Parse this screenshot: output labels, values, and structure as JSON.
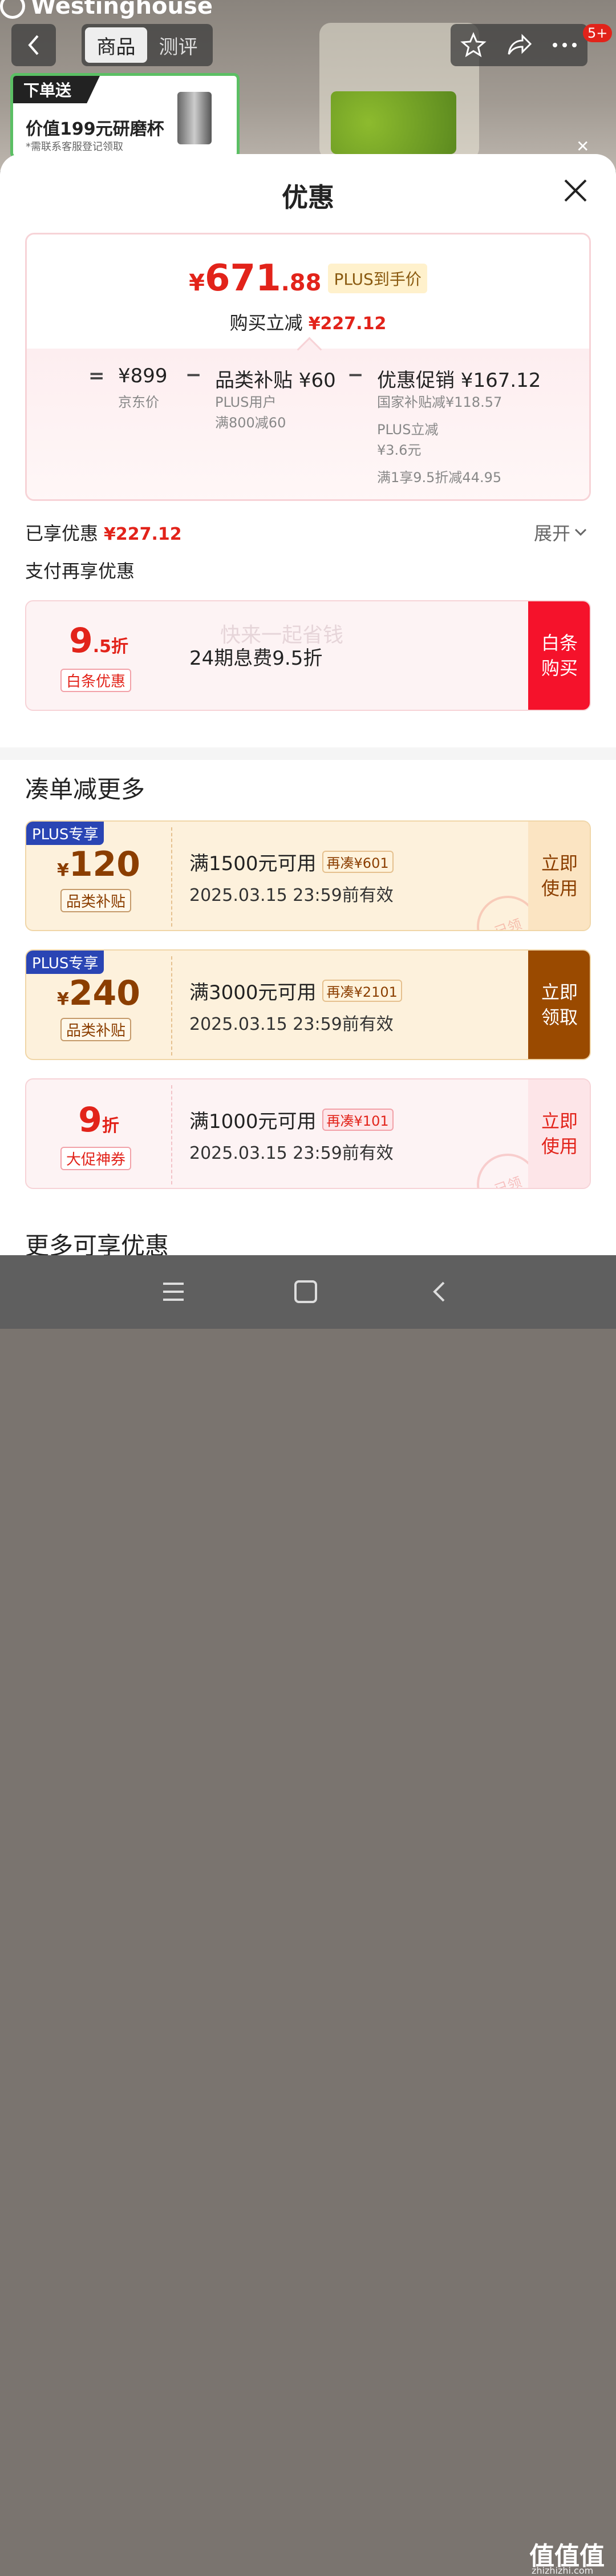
{
  "background": {
    "brand": "Westinghouse",
    "tabs": [
      "商品",
      "测评"
    ],
    "active_tab": 0,
    "notification_badge": "5+",
    "gift": {
      "tag": "下单送",
      "title": "价值199元研磨杯",
      "note": "*需联系客服登记领取"
    }
  },
  "sheet": {
    "title": "优惠",
    "final_price": {
      "yen": "¥",
      "int": "671",
      "dec": ".88"
    },
    "plus_label": "PLUS到手价",
    "save_label": "购买立减",
    "save_amount": "¥227.12",
    "breakdown": {
      "equals": "=",
      "minus": "−",
      "jd_price": "¥899",
      "jd_label": "京东价",
      "subsidy_title": "品类补贴 ¥60",
      "subsidy_sub1": "PLUS用户",
      "subsidy_sub2": "满800减60",
      "promo_title": "优惠促销 ¥167.12",
      "promo_sub1": "国家补贴减¥118.57",
      "promo_sub2": "PLUS立减",
      "promo_sub3": "¥3.6元",
      "promo_sub4": "满1享9.5折减44.95"
    },
    "enjoyed_label": "已享优惠",
    "enjoyed_amount": "¥227.12",
    "expand_label": "展开",
    "pay_more_label": "支付再享优惠",
    "baitiao": {
      "disc_big": "9",
      "disc_small": ".5折",
      "tag": "白条优惠",
      "text": "24期息费9.5折",
      "watermark": "快来一起省钱",
      "button": "白条\n购买"
    },
    "more_title": "凑单减更多",
    "coupons": [
      {
        "corner": "PLUS专享",
        "cur": "¥",
        "num": "120",
        "tag": "品类补贴",
        "cond": "满1500元可用",
        "more": "再凑¥601",
        "valid": "2025.03.15 23:59前有效",
        "button": "立即\n使用",
        "stamp": "已领"
      },
      {
        "corner": "PLUS专享",
        "cur": "¥",
        "num": "240",
        "tag": "品类补贴",
        "cond": "满3000元可用",
        "more": "再凑¥2101",
        "valid": "2025.03.15 23:59前有效",
        "button": "立即\n领取"
      },
      {
        "num": "9",
        "suf": "折",
        "tag": "大促神券",
        "cond": "满1000元可用",
        "more": "再凑¥101",
        "valid": "2025.03.15 23:59前有效",
        "button": "立即\n使用",
        "stamp": "已领"
      }
    ],
    "more_enjoy_title": "更多可享优惠"
  },
  "watermark": {
    "main": "值值值",
    "sub": "zhizhizhi.com"
  },
  "colors": {
    "accent_red": "#e2231a",
    "coupon_brown": "#8b3e00",
    "plus_blue": "#2a45b4"
  }
}
